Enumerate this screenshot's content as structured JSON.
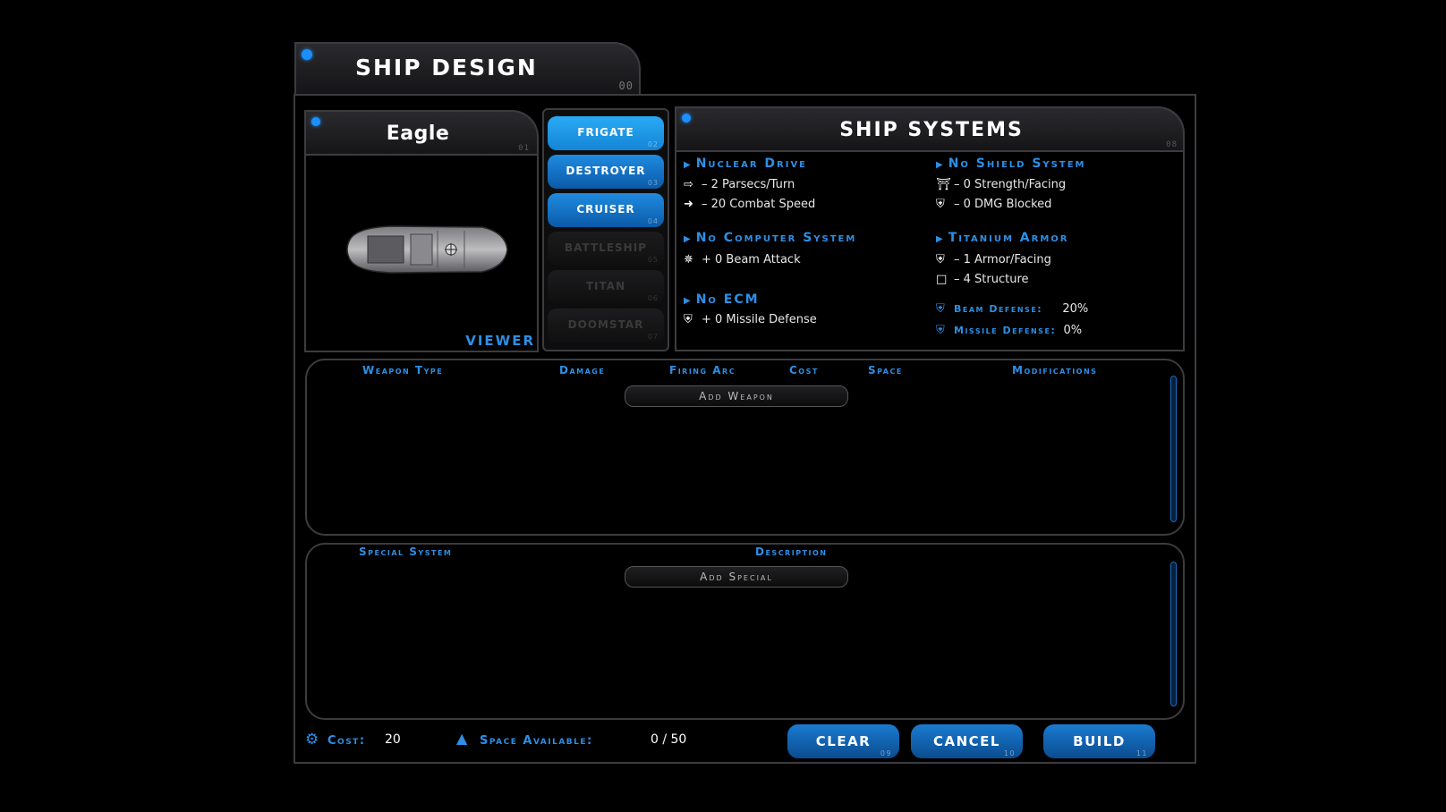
{
  "header": {
    "title": "SHIP DESIGN",
    "num": "00"
  },
  "ship": {
    "name": "Eagle",
    "num": "01",
    "viewer_label": "VIEWER"
  },
  "hulls": [
    {
      "label": "FRIGATE",
      "num": "02"
    },
    {
      "label": "DESTROYER",
      "num": "03"
    },
    {
      "label": "CRUISER",
      "num": "04"
    },
    {
      "label": "BATTLESHIP",
      "num": "05"
    },
    {
      "label": "TITAN",
      "num": "06"
    },
    {
      "label": "DOOMSTAR",
      "num": "07"
    }
  ],
  "systems": {
    "title": "SHIP SYSTEMS",
    "num": "08",
    "drive": {
      "name": "Nuclear Drive",
      "line1": "– 2 Parsecs/Turn",
      "line2": "– 20 Combat Speed"
    },
    "computer": {
      "name": "No Computer System",
      "line1": "+ 0 Beam Attack"
    },
    "ecm": {
      "name": "No ECM",
      "line1": "+ 0 Missile Defense"
    },
    "shield": {
      "name": "No Shield System",
      "line1": "– 0 Strength/Facing",
      "line2": "– 0 DMG Blocked"
    },
    "armor": {
      "name": "Titanium Armor",
      "line1": "– 1 Armor/Facing",
      "line2": "– 4 Structure"
    },
    "beam_defense_label": "Beam Defense:",
    "beam_defense_value": "20%",
    "missile_defense_label": "Missile Defense:",
    "missile_defense_value": "0%"
  },
  "weapons": {
    "columns": [
      "Weapon Type",
      "Damage",
      "Firing Arc",
      "Cost",
      "Space",
      "Modifications"
    ],
    "add_label": "Add Weapon"
  },
  "specials": {
    "columns": [
      "Special System",
      "Description"
    ],
    "add_label": "Add Special"
  },
  "footer": {
    "cost_label": "Cost:",
    "cost_value": "20",
    "space_label": "Space Available:",
    "space_value": "0 / 50",
    "clear": {
      "label": "CLEAR",
      "num": "09"
    },
    "cancel": {
      "label": "CANCEL",
      "num": "10"
    },
    "build": {
      "label": "BUILD",
      "num": "11"
    }
  },
  "colors": {
    "accent": "#2d8fe6",
    "button": "#0b5aa8",
    "border": "#3c3c40"
  }
}
